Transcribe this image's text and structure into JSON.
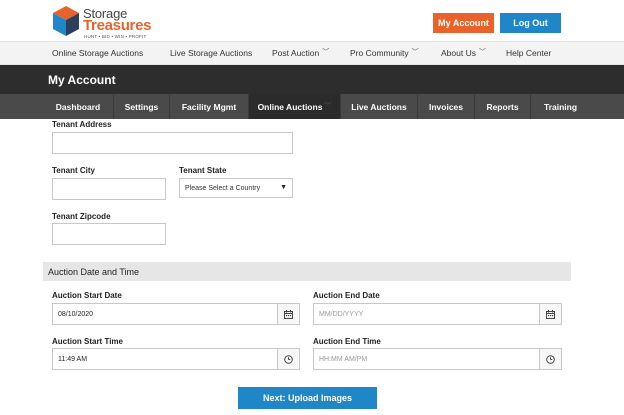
{
  "logo": {
    "word1": "Storage",
    "word2": "Treasures",
    "tagline": "HUNT • BID • WIN • PROFIT"
  },
  "header": {
    "my_account_label": "My Account",
    "logout_label": "Log Out"
  },
  "top_nav": {
    "items": [
      {
        "label": "Online Storage Auctions"
      },
      {
        "label": "Live Storage Auctions"
      },
      {
        "label": "Post Auction"
      },
      {
        "label": "Pro Community"
      },
      {
        "label": "About Us"
      },
      {
        "label": "Help Center"
      }
    ]
  },
  "account_bar": {
    "title": "My Account"
  },
  "sub_nav": {
    "items": [
      {
        "label": "Dashboard"
      },
      {
        "label": "Settings"
      },
      {
        "label": "Facility Mgmt"
      },
      {
        "label": "Online Auctions"
      },
      {
        "label": "Live Auctions"
      },
      {
        "label": "Invoices"
      },
      {
        "label": "Reports"
      },
      {
        "label": "Training"
      }
    ],
    "active": "Online Auctions"
  },
  "form": {
    "tenant_address_label": "Tenant Address",
    "tenant_address_value": "",
    "tenant_city_label": "Tenant City",
    "tenant_city_value": "",
    "tenant_state_label": "Tenant State",
    "tenant_state_selected": "Please Select a Country",
    "tenant_zip_label": "Tenant Zipcode",
    "tenant_zip_value": "",
    "section_title": "Auction Date and Time",
    "start_date_label": "Auction Start Date",
    "start_date_value": "08/10/2020",
    "end_date_label": "Auction End Date",
    "end_date_placeholder": "MM/DD/YYYY",
    "start_time_label": "Auction Start Time",
    "start_time_value": "11:49 AM",
    "end_time_label": "Auction End Time",
    "end_time_placeholder": "HH:MM AM/PM",
    "next_button_label": "Next: Upload Images"
  },
  "colors": {
    "brand_orange": "#e8632b",
    "brand_blue": "#1f86c8",
    "dark_bar": "#2d2d2d",
    "sub_nav": "#4a4a4a"
  },
  "icons": [
    "logo-cube-icon",
    "chevron-down-icon",
    "calendar-icon",
    "clock-icon"
  ]
}
